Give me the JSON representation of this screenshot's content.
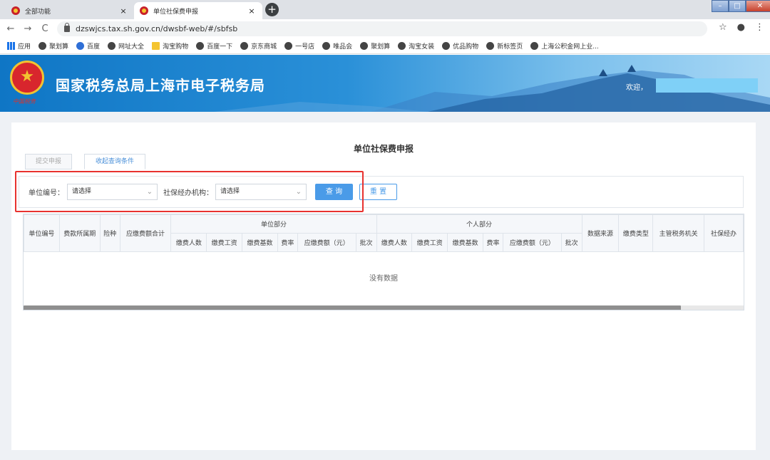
{
  "browser": {
    "tabs": [
      {
        "title": "全部功能",
        "active": false
      },
      {
        "title": "单位社保费申报",
        "active": true
      }
    ],
    "close_glyph": "×",
    "new_tab_glyph": "+",
    "url": "dzswjcs.tax.sh.gov.cn/dwsbf-web/#/sbfsb",
    "bookmarks": [
      "应用",
      "聚划算",
      "百度",
      "网址大全",
      "淘宝购物",
      "百度一下",
      "京东商城",
      "一号店",
      "唯品会",
      "聚划算",
      "淘宝女装",
      "优品购物",
      "新标签页",
      "上海公积金网上业..."
    ]
  },
  "banner": {
    "title": "国家税务总局上海市电子税务局",
    "seal_text": "中国税务",
    "welcome": "欢迎，"
  },
  "page": {
    "title": "单位社保费申报",
    "tabs": {
      "submit": "提交申报",
      "toggle": "收起查询条件"
    },
    "search": {
      "unit_label": "单位编号：",
      "unit_value": "请选择",
      "agency_label": "社保经办机构：",
      "agency_value": "请选择",
      "query_button": "查 询",
      "reset_button": "重 置"
    },
    "table": {
      "columns_left": [
        "单位编号",
        "费款所属期",
        "险种",
        "应缴费额合计"
      ],
      "group_unit": "单位部分",
      "group_personal": "个人部分",
      "sub_columns": [
        "缴费人数",
        "缴费工资",
        "缴费基数",
        "费率",
        "应缴费额（元）",
        "批次"
      ],
      "columns_right": [
        "数据来源",
        "缴费类型",
        "主管税务机关",
        "社保经办"
      ],
      "empty_text": "没有数据"
    }
  }
}
